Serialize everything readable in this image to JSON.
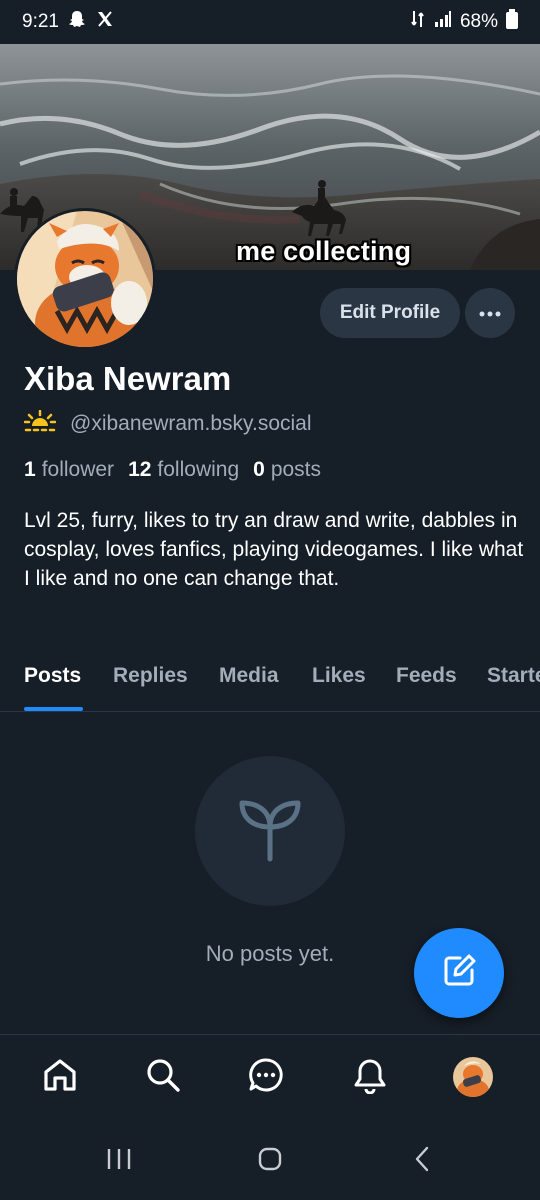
{
  "status_bar": {
    "time": "9:21",
    "battery": "68%",
    "icons": [
      "snapchat-icon",
      "x-icon",
      "data-icon",
      "signal-icon",
      "battery-icon"
    ]
  },
  "banner": {
    "caption": "me collecting"
  },
  "profile": {
    "display_name": "Xiba Newram",
    "handle": "@xibanewram.bsky.social",
    "followers_count": "1",
    "followers_label": "follower",
    "following_count": "12",
    "following_label": "following",
    "posts_count": "0",
    "posts_label": "posts",
    "bio": "Lvl 25, furry, likes to try an draw and write, dabbles in cosplay, loves fanfics, playing videogames. I like what I like and no one can change that."
  },
  "actions": {
    "edit_profile": "Edit Profile"
  },
  "tabs": [
    {
      "label": "Posts",
      "active": true
    },
    {
      "label": "Replies",
      "active": false
    },
    {
      "label": "Media",
      "active": false
    },
    {
      "label": "Likes",
      "active": false
    },
    {
      "label": "Feeds",
      "active": false
    },
    {
      "label": "Starte",
      "active": false
    }
  ],
  "empty_state": {
    "text": "No posts yet."
  },
  "bottom_nav": [
    "home-icon",
    "search-icon",
    "chat-icon",
    "bell-icon",
    "profile-avatar"
  ],
  "colors": {
    "background": "#161e27",
    "accent": "#208bfe",
    "secondary_text": "#a1adb9",
    "button_bg": "#2a3644"
  }
}
